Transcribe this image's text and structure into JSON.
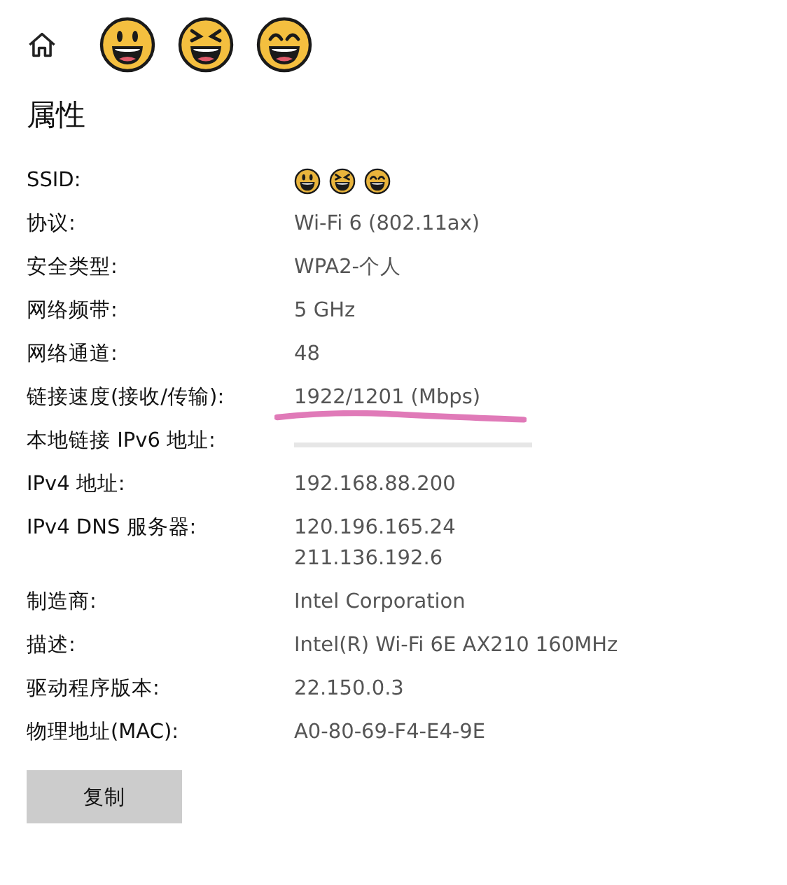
{
  "header_emojis": [
    {
      "kind": "grin"
    },
    {
      "kind": "squint"
    },
    {
      "kind": "smile"
    }
  ],
  "title": "属性",
  "properties": [
    {
      "label": "SSID:",
      "emojis": [
        {
          "kind": "grin"
        },
        {
          "kind": "squint"
        },
        {
          "kind": "smile"
        }
      ]
    },
    {
      "label": "协议:",
      "value": "Wi-Fi 6 (802.11ax)"
    },
    {
      "label": "安全类型:",
      "value": "WPA2-个人"
    },
    {
      "label": "网络频带:",
      "value": "5 GHz"
    },
    {
      "label": "网络通道:",
      "value": "48"
    },
    {
      "label": "链接速度(接收/传输):",
      "value": "1922/1201 (Mbps)",
      "highlighted": true
    },
    {
      "label": "本地链接 IPv6 地址:",
      "obscured": true
    },
    {
      "label": "IPv4 地址:",
      "value": "192.168.88.200"
    },
    {
      "label": "IPv4 DNS 服务器:",
      "values": [
        "120.196.165.24",
        "211.136.192.6"
      ]
    },
    {
      "label": "制造商:",
      "value": "Intel Corporation"
    },
    {
      "label": "描述:",
      "value": "Intel(R) Wi-Fi 6E AX210 160MHz"
    },
    {
      "label": "驱动程序版本:",
      "value": "22.150.0.3"
    },
    {
      "label": "物理地址(MAC):",
      "value": "A0-80-69-F4-E4-9E"
    }
  ],
  "copy_button": "复制"
}
